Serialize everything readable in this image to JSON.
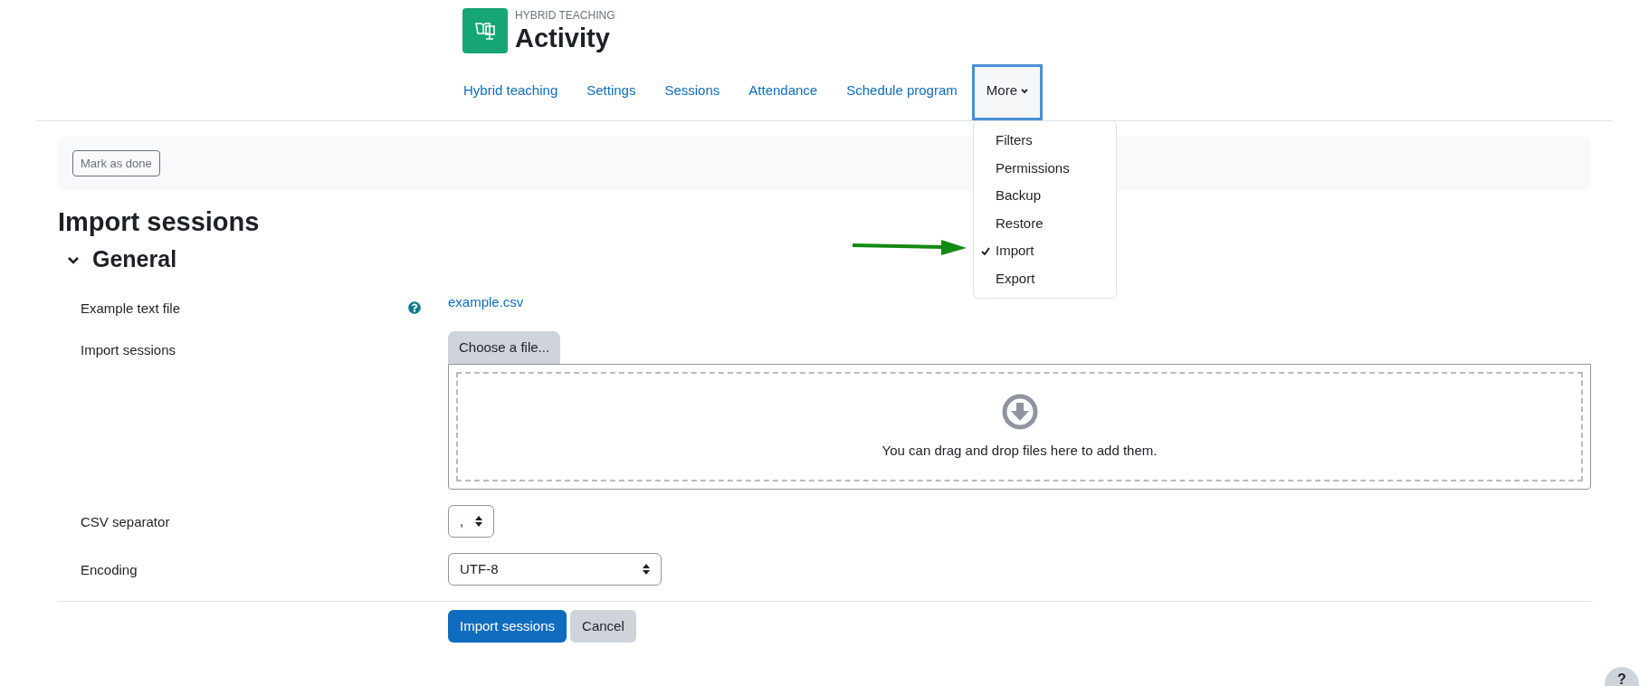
{
  "header": {
    "category": "HYBRID TEACHING",
    "title": "Activity"
  },
  "nav": {
    "tabs": [
      {
        "label": "Hybrid teaching",
        "selected": false,
        "kind": "link"
      },
      {
        "label": "Settings",
        "selected": false,
        "kind": "link"
      },
      {
        "label": "Sessions",
        "selected": false,
        "kind": "link"
      },
      {
        "label": "Attendance",
        "selected": false,
        "kind": "link"
      },
      {
        "label": "Schedule program",
        "selected": false,
        "kind": "link"
      },
      {
        "label": "More",
        "selected": true,
        "kind": "dropdown"
      }
    ]
  },
  "more_menu": {
    "items": [
      {
        "label": "Filters",
        "checked": false
      },
      {
        "label": "Permissions",
        "checked": false
      },
      {
        "label": "Backup",
        "checked": false
      },
      {
        "label": "Restore",
        "checked": false
      },
      {
        "label": "Import",
        "checked": true
      },
      {
        "label": "Export",
        "checked": false
      }
    ]
  },
  "completion": {
    "button": "Mark as done"
  },
  "page_title": "Import sessions",
  "section": {
    "title": "General",
    "expanded": true
  },
  "form": {
    "rows": [
      {
        "kind": "link",
        "label": "Example text file",
        "help": true,
        "value": "example.csv"
      },
      {
        "kind": "file",
        "label": "Import sessions",
        "help": false,
        "button": "Choose a file...",
        "drop_text": "You can drag and drop files here to add them."
      },
      {
        "kind": "select",
        "label": "CSV separator",
        "help": false,
        "value": ",",
        "wide": false
      },
      {
        "kind": "select",
        "label": "Encoding",
        "help": false,
        "value": "UTF-8",
        "wide": true
      }
    ]
  },
  "actions": [
    {
      "label": "Import sessions",
      "kind": "primary"
    },
    {
      "label": "Cancel",
      "kind": "secondary"
    }
  ],
  "help_button": "?"
}
